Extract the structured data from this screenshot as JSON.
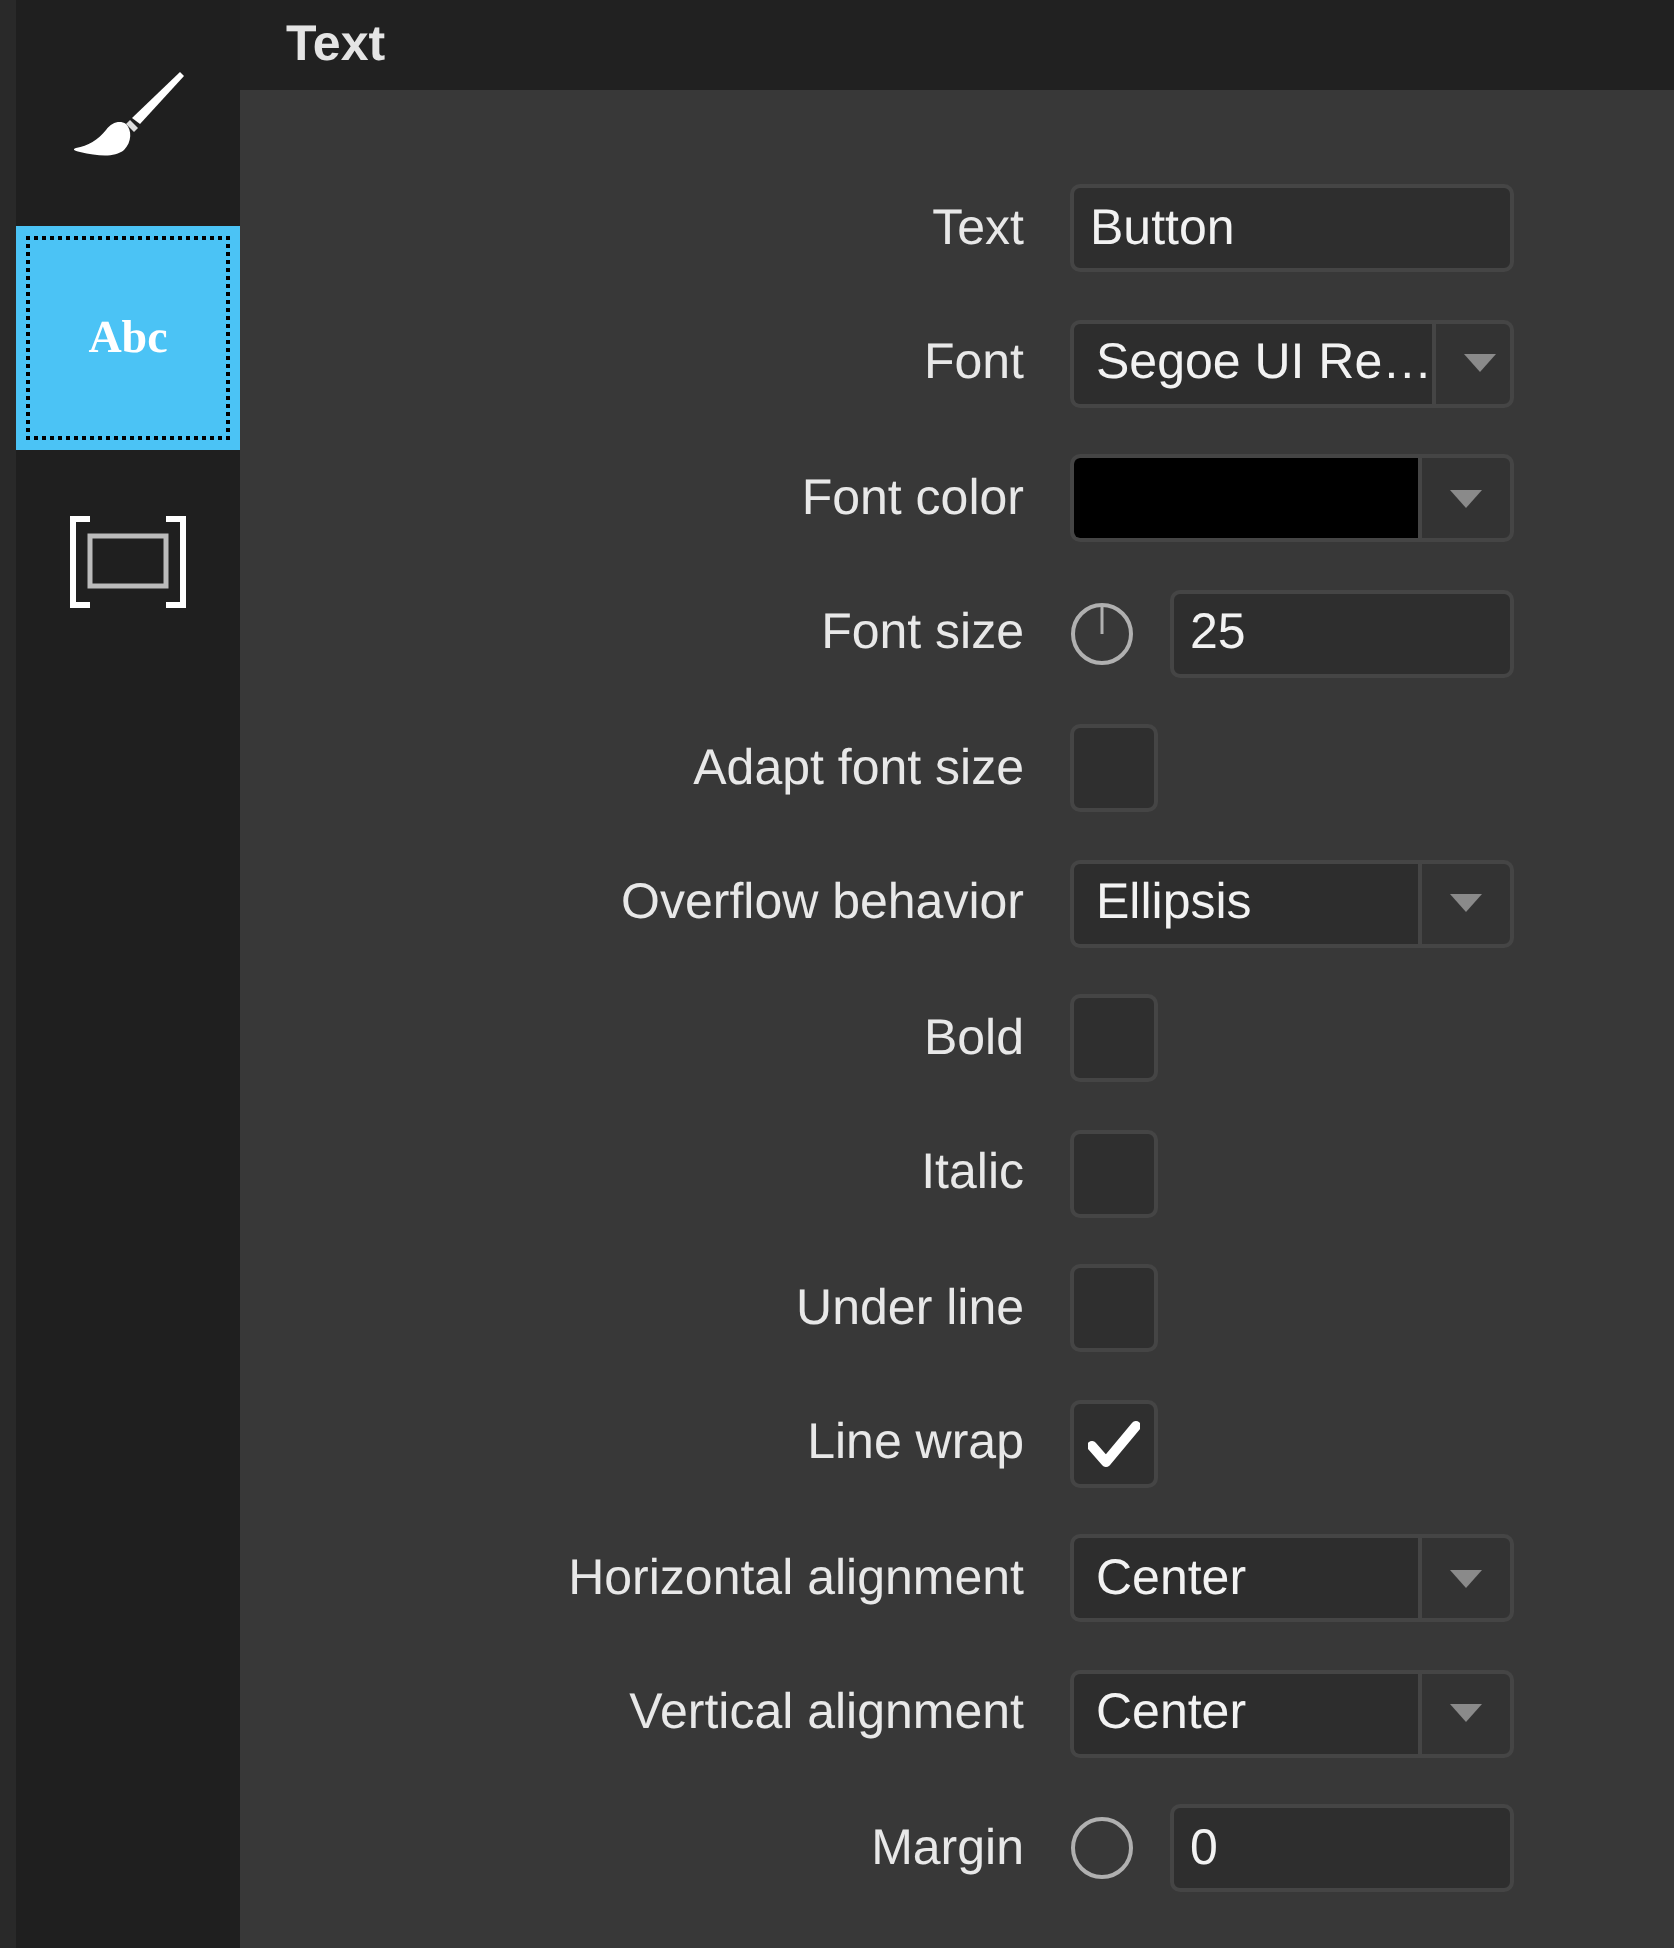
{
  "sidebar": {
    "tabs": [
      {
        "kind": "brush",
        "selected": false
      },
      {
        "kind": "text",
        "label": "Abc",
        "selected": true
      },
      {
        "kind": "frame",
        "selected": false
      }
    ]
  },
  "panel": {
    "title": "Text"
  },
  "properties": [
    {
      "kind": "text",
      "label": "Text",
      "value": "Button"
    },
    {
      "kind": "dropdown",
      "label": "Font",
      "value": "Segoe UI Re…"
    },
    {
      "kind": "color",
      "label": "Font color",
      "color": "#000000"
    },
    {
      "kind": "knob",
      "label": "Font size",
      "value": "25",
      "pointer": true
    },
    {
      "kind": "checkbox",
      "label": "Adapt font size",
      "checked": false
    },
    {
      "kind": "dropdown",
      "label": "Overflow behavior",
      "value": "Ellipsis"
    },
    {
      "kind": "checkbox",
      "label": "Bold",
      "checked": false
    },
    {
      "kind": "checkbox",
      "label": "Italic",
      "checked": false
    },
    {
      "kind": "checkbox",
      "label": "Under line",
      "checked": false
    },
    {
      "kind": "checkbox",
      "label": "Line wrap",
      "checked": true
    },
    {
      "kind": "dropdown",
      "label": "Horizontal alignment",
      "value": "Center"
    },
    {
      "kind": "dropdown",
      "label": "Vertical alignment",
      "value": "Center"
    },
    {
      "kind": "knob",
      "label": "Margin",
      "value": "0",
      "pointer": false
    }
  ]
}
